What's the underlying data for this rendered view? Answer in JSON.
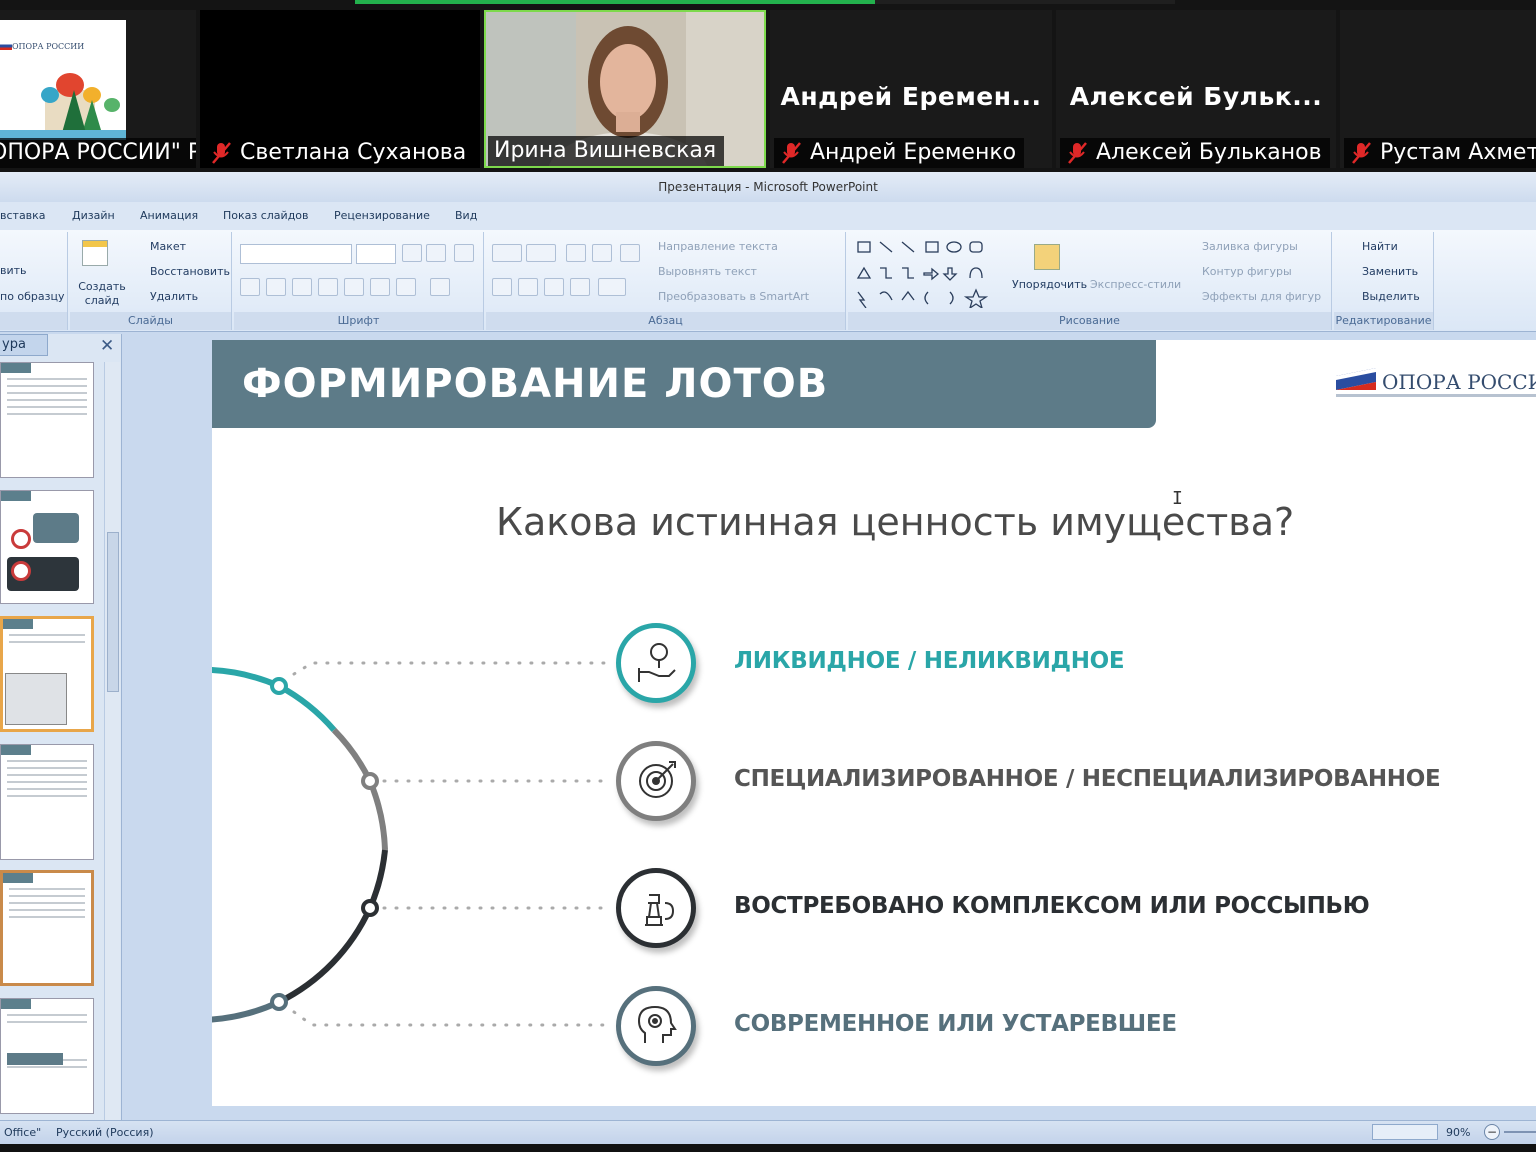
{
  "meeting": {
    "participants": [
      {
        "name": "ОПОРА РОССИИ\" Р...",
        "muted": false,
        "video": "logo",
        "logo_text": "ОПОРА РОССИИ"
      },
      {
        "name": "Светлана Суханова",
        "muted": true,
        "video": "off"
      },
      {
        "name": "Ирина Вишневская",
        "muted": false,
        "video": "camera",
        "active": true
      },
      {
        "name": "Андрей Еременко",
        "display": "Андрей  Еремен...",
        "muted": true,
        "video": "off"
      },
      {
        "name": "Алексей Бульканов",
        "display": "Алексей  Бульк...",
        "muted": true,
        "video": "off"
      },
      {
        "name": "Рустам Ахметга",
        "muted": true,
        "video": "off"
      }
    ]
  },
  "powerpoint": {
    "title": "Презентация - Microsoft PowerPoint",
    "tabs": [
      "вставка",
      "Дизайн",
      "Анимация",
      "Показ слайдов",
      "Рецензирование",
      "Вид"
    ],
    "ribbon": {
      "clipboard": {
        "items": [
          "вить",
          "по образцу"
        ]
      },
      "slides": {
        "label": "Слайды",
        "create": "Создать слайд",
        "layout": "Макет",
        "reset": "Восстановить",
        "delete": "Удалить"
      },
      "font": {
        "label": "Шрифт"
      },
      "paragraph": {
        "label": "Абзац",
        "text_direction": "Направление текста",
        "align_text": "Выровнять текст",
        "smartart": "Преобразовать в SmartArt"
      },
      "drawing": {
        "label": "Рисование",
        "arrange": "Упорядочить",
        "quick_styles": "Экспресс-стили",
        "fill": "Заливка фигуры",
        "outline": "Контур фигуры",
        "effects": "Эффекты для фигур"
      },
      "editing": {
        "label": "Редактирование",
        "find": "Найти",
        "replace": "Заменить",
        "select": "Выделить"
      }
    },
    "pane_tab": "ура",
    "status": {
      "theme": "Office\"",
      "language": "Русский (Россия)",
      "zoom": "90%"
    }
  },
  "slide": {
    "title": "ФОРМИРОВАНИЕ ЛОТОВ",
    "logo": "ОПОРА РОССИИ",
    "question": "Какова истинная ценность имущества?",
    "items": [
      {
        "text": "ЛИКВИДНОЕ / НЕЛИКВИДНОЕ",
        "color": "#2aa6a8",
        "icon": "hand-coin-icon"
      },
      {
        "text": "СПЕЦИАЛИЗИРОВАННОЕ / НЕСПЕЦИАЛИЗИРОВАННОЕ",
        "color": "#555555",
        "icon": "target-icon"
      },
      {
        "text": "ВОСТРЕБОВАНО КОМПЛЕКСОМ ИЛИ РОССЫПЬЮ",
        "color": "#2b2f33",
        "icon": "chess-icon"
      },
      {
        "text": "СОВРЕМЕННОЕ ИЛИ УСТАРЕВШЕЕ",
        "color": "#56707c",
        "icon": "head-gear-icon"
      }
    ],
    "colors": {
      "banner": "#5d7b88",
      "teal": "#2aa6a8",
      "gray": "#7f7f7f",
      "dark": "#2b2f33",
      "slate": "#56707c"
    }
  }
}
